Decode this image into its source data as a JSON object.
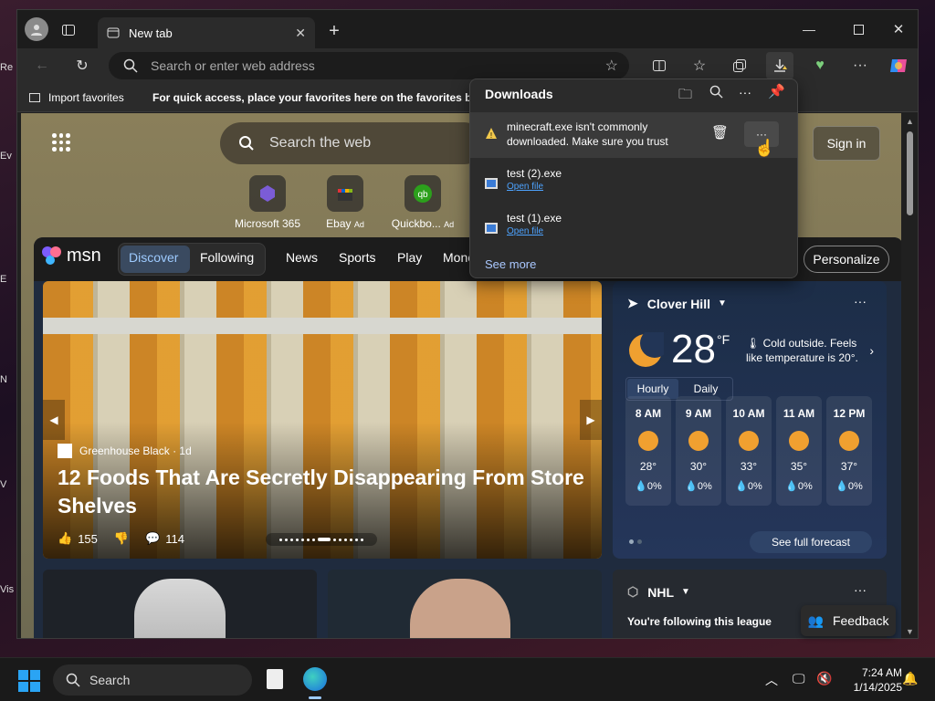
{
  "window": {
    "tab_title": "New tab",
    "address_placeholder": "Search or enter web address",
    "favorites_bar": {
      "import_label": "Import favorites",
      "message": "For quick access, place your favorites here on the favorites bar."
    }
  },
  "newtab": {
    "search_placeholder": "Search the web",
    "sign_in": "Sign in",
    "tiles": [
      {
        "label": "Microsoft 365",
        "ad": ""
      },
      {
        "label": "Ebay",
        "ad": "Ad"
      },
      {
        "label": "Quickbo...",
        "ad": "Ad"
      }
    ]
  },
  "msn": {
    "logo": "msn",
    "tabs": [
      "Discover",
      "Following"
    ],
    "nav": [
      "News",
      "Sports",
      "Play",
      "Mone"
    ],
    "personalize": "Personalize",
    "hero": {
      "source": "Greenhouse Black",
      "age": "· 1d",
      "headline": "12 Foods That Are Secretly Disappearing From Store Shelves",
      "likes": "155",
      "comments": "114"
    },
    "weather": {
      "location": "Clover Hill",
      "temp": "28",
      "unit": "°F",
      "summary": "Cold outside. Feels like temperature is 20°.",
      "tabs": [
        "Hourly",
        "Daily"
      ],
      "hours": [
        {
          "time": "8 AM",
          "temp": "28°",
          "precip": "0%"
        },
        {
          "time": "9 AM",
          "temp": "30°",
          "precip": "0%"
        },
        {
          "time": "10 AM",
          "temp": "33°",
          "precip": "0%"
        },
        {
          "time": "11 AM",
          "temp": "35°",
          "precip": "0%"
        },
        {
          "time": "12 PM",
          "temp": "37°",
          "precip": "0%"
        }
      ],
      "forecast_button": "See full forecast"
    },
    "nhl": {
      "title": "NHL",
      "following": "You're following this league"
    },
    "feedback": "Feedback"
  },
  "downloads": {
    "title": "Downloads",
    "warning": "minecraft.exe isn't commonly downloaded. Make sure you trust minecraft.exe before you open it.",
    "items": [
      {
        "name": "test (2).exe",
        "action": "Open file"
      },
      {
        "name": "test (1).exe",
        "action": "Open file"
      }
    ],
    "see_more": "See more"
  },
  "taskbar": {
    "search": "Search",
    "time": "7:24 AM",
    "date": "1/14/2025"
  },
  "colors": {
    "accent": "#0a84ff",
    "warning": "#f2c94c",
    "link": "#4da3ff"
  }
}
